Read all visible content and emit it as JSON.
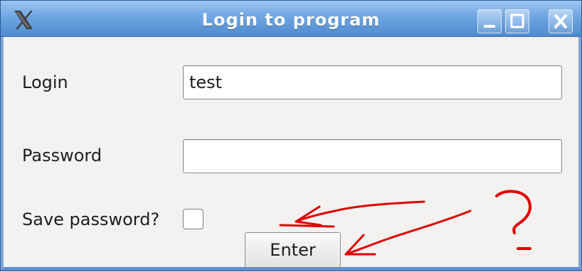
{
  "window": {
    "title": "Login to program"
  },
  "form": {
    "login_label": "Login",
    "login_value": "test",
    "password_label": "Password",
    "password_value": "",
    "save_label": "Save password?",
    "save_checked": false,
    "enter_label": "Enter"
  },
  "annotation": {
    "question_mark": "?",
    "color": "#e00000"
  }
}
